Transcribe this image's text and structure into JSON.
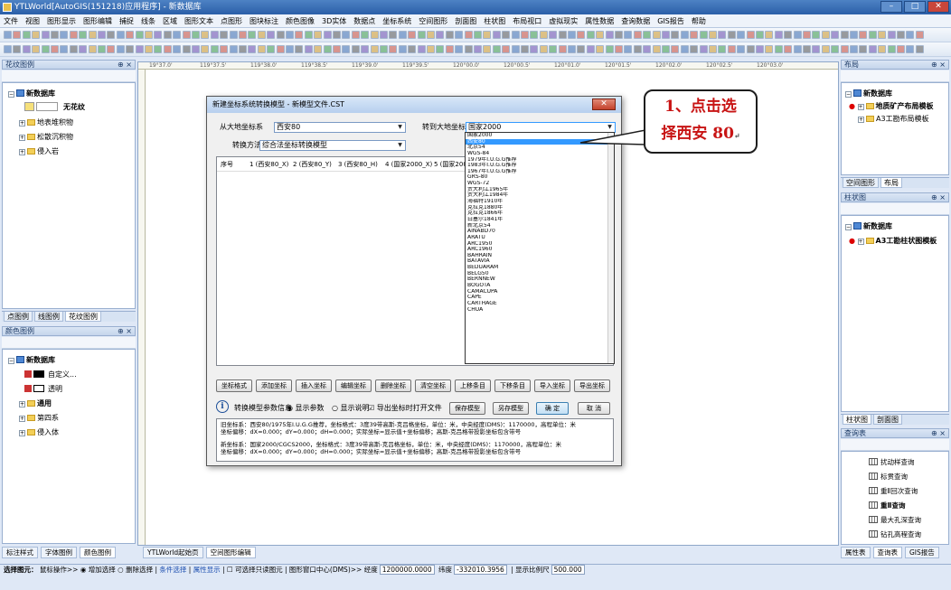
{
  "window": {
    "title": "YTLWorld[AutoGIS(151218)应用程序] - 新数据库"
  },
  "menu": [
    "文件",
    "视图",
    "图形显示",
    "图形编辑",
    "捕捉",
    "线条",
    "区域",
    "图形文本",
    "点图形",
    "图块标注",
    "颜色图像",
    "3D实体",
    "数据点",
    "坐标系统",
    "空间图形",
    "剖面图",
    "柱状图",
    "布局视口",
    "虚拟现实",
    "属性数据",
    "查询数据",
    "GIS报告",
    "帮助"
  ],
  "ruler": {
    "ticks": [
      "19°37.0'",
      "119°37.5'",
      "119°38.0'",
      "119°38.5'",
      "119°39.0'",
      "119°39.5'",
      "120°00.0'",
      "120°00.5'",
      "120°01.0'",
      "120°01.5'",
      "120°02.0'",
      "120°02.5'",
      "120°03.0'"
    ]
  },
  "left_top_panel": {
    "title": "花纹图例",
    "root": "新数据库",
    "items": [
      "无花纹",
      "地表堆积物",
      "松散沉积物",
      "侵入岩"
    ]
  },
  "left_top_tabs": [
    "点图例",
    "线图例",
    "花纹图例"
  ],
  "left_bottom_panel": {
    "title": "颜色图例",
    "root": "新数据库",
    "items": [
      "自定义...",
      "透明",
      "通用",
      "第四系",
      "侵入体"
    ]
  },
  "left_bottom_tabs": [
    "标注样式",
    "字体图例",
    "颜色图例"
  ],
  "right_top_panel": {
    "title": "布局",
    "root": "新数据库",
    "items": [
      "地质矿产布局模板",
      "A3工勘布局模板"
    ]
  },
  "right_mid_tabs": [
    "空间图形",
    "布局"
  ],
  "right_mid_panel": {
    "title": "柱状图",
    "root": "新数据库",
    "items": [
      "A3工勘柱状图模板"
    ]
  },
  "right_mid_tabs2": [
    "柱状图",
    "剖面图"
  ],
  "right_bottom_panel": {
    "title": "查询表",
    "items": [
      "扰动样查询",
      "标贯查询",
      "重Ⅱ回次查询",
      "重Ⅱ查询",
      "最大孔深查询",
      "钻孔高程查询"
    ]
  },
  "right_bottom_tabs": [
    "属性表",
    "查询表",
    "GIS报告"
  ],
  "doc_tabs": [
    "YTLWorld起始页",
    "空间图形编辑"
  ],
  "dialog": {
    "title": "新建坐标系统转换模型 - 新模型文件.CST",
    "from_label": "从大地坐标系",
    "from_value": "西安80",
    "to_label": "转到大地坐标系",
    "to_value": "国家2000",
    "method_label": "转换方法",
    "method_value": "综合法坐标转换模型",
    "columns": [
      "序号",
      "1 (西安80_X)",
      "2 (西安80_Y)",
      "3 (西安80_H)",
      "4 (国家2000_X)",
      "5 (国家2000_Y)"
    ],
    "buttons": [
      "坐标格式",
      "添加坐标",
      "插入坐标",
      "编辑坐标",
      "删除坐标",
      "清空坐标",
      "上移条目",
      "下移条目",
      "导入坐标",
      "导出坐标"
    ],
    "option_label": "转换模型参数信息",
    "radio_params": "显示参数",
    "radio_help": "显示说明",
    "check_export": "导出坐标时打开文件",
    "save_btn": "保存模型",
    "saveas_btn": "另存模型",
    "ok_btn": "确 定",
    "cancel_btn": "取 消",
    "info_old": "旧坐标系：西安80/1975年I.U.G.G推荐，坐标格式：3度39带高斯-克吕格坐标，单位：米，中央经度(DMS)：1170000，高程单位：米",
    "info_old2": "坐标偏移：dX=0.000；dY=0.000；dH=0.000；实际坐标=显示值+坐标偏移；高斯-克吕格带投影坐标包含带号",
    "info_new": "新坐标系：国家2000/CGCS2000，坐标格式：3度39带高斯-克吕格坐标，单位：米，中央经度(DMS)：1170000，高程单位：米",
    "info_new2": "坐标偏移：dX=0.000；dY=0.000；dH=0.000；实际坐标=显示值+坐标偏移；高斯-克吕格带投影坐标包含带号"
  },
  "dropdown": {
    "selected_index": 1,
    "options": [
      "国家2000",
      "西安80",
      "北京54",
      "WGS-84",
      "1979年I.U.G.G推荐",
      "1983年I.U.G.G推荐",
      "1967年I.U.G.G推荐",
      "GRS-80",
      "WGS-72",
      "贾大利江1965年",
      "贾大利江1984年",
      "海福特1910年",
      "克拉克1880年",
      "克拉克1866年",
      "白塞尔1841年",
      "新北京54",
      "AINABD70",
      "ARATU",
      "ARC1950",
      "ARC1960",
      "BAHRAIN",
      "BATAVIA",
      "BEDUARAM",
      "BELG50",
      "BERNNEW",
      "BOGOTA",
      "CAMACUPA",
      "CAPE",
      "CARTHAGE",
      "CHUA"
    ]
  },
  "callout": {
    "line1": "1、点击选",
    "line2": "择西安 80"
  },
  "status": {
    "label": "选择图元：",
    "mode": "鼠标操作>>",
    "add": "增加选择",
    "del": "删除选择",
    "cond": "条件选择",
    "attr": "属性显示",
    "readonly": "可选择只读图元",
    "center": "图形窗口中心(DMS)>>",
    "lon_label": "经度",
    "lon": "1200000.0000",
    "lat_label": "纬度",
    "lat": "-332010.3956",
    "scale_label": "显示比例尺",
    "scale": "500.000"
  }
}
